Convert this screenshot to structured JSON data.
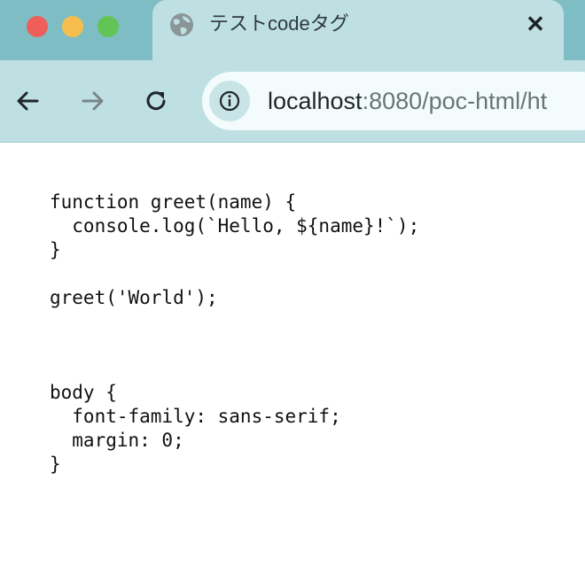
{
  "window": {
    "controls": [
      "close",
      "minimize",
      "zoom"
    ]
  },
  "tab": {
    "title": "テストcodeタグ",
    "favicon": "globe-icon",
    "close_label": "✕"
  },
  "toolbar": {
    "back_icon": "back-arrow-icon",
    "forward_icon": "forward-arrow-icon",
    "reload_icon": "reload-icon",
    "site_info_icon": "info-icon"
  },
  "address_bar": {
    "host": "localhost",
    "path": ":8080/poc-html/ht"
  },
  "page": {
    "code_js": "function greet(name) {\n  console.log(`Hello, ${name}!`);\n}\n\ngreet('World');",
    "code_css": "body {\n  font-family: sans-serif;\n  margin: 0;\n}"
  },
  "colors": {
    "tabstrip": "#7fbdc4",
    "active_tab": "#bfe0e3",
    "omnibox": "#f3fbfc",
    "close_red": "#ee5f5a",
    "minimize_yellow": "#f6be4f",
    "zoom_green": "#61c454"
  }
}
